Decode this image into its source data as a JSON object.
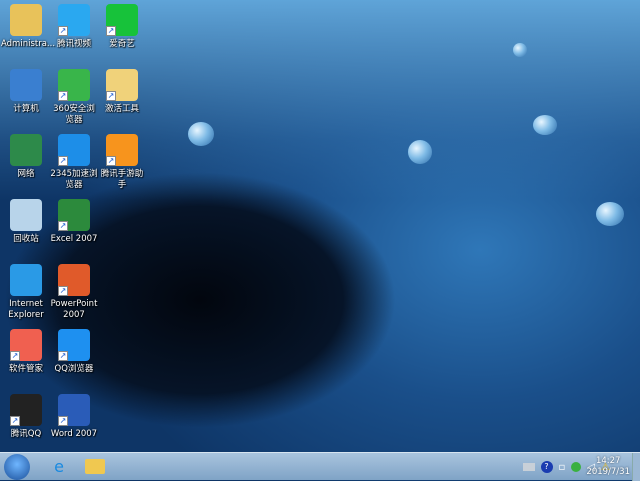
{
  "desktop": {
    "icons": [
      {
        "label": "Administra...",
        "icon": "user-folder-icon",
        "color": "#e8c25a",
        "shortcut": false
      },
      {
        "label": "腾讯视频",
        "icon": "tencent-video-icon",
        "color": "#2aa8f0",
        "shortcut": true
      },
      {
        "label": "爱奇艺",
        "icon": "iqiyi-icon",
        "color": "#17c23a",
        "shortcut": true
      },
      {
        "label": "计算机",
        "icon": "computer-icon",
        "color": "#3a7fd0",
        "shortcut": false
      },
      {
        "label": "360安全浏览器",
        "icon": "360-browser-icon",
        "color": "#39b54a",
        "shortcut": true
      },
      {
        "label": "激活工具",
        "icon": "folder-icon",
        "color": "#f0d27a",
        "shortcut": true
      },
      {
        "label": "网络",
        "icon": "network-icon",
        "color": "#2d8a4a",
        "shortcut": false
      },
      {
        "label": "2345加速浏览器",
        "icon": "2345-browser-icon",
        "color": "#1d8ee8",
        "shortcut": true
      },
      {
        "label": "腾讯手游助手",
        "icon": "tencent-game-assistant-icon",
        "color": "#f7941d",
        "shortcut": true
      },
      {
        "label": "回收站",
        "icon": "recycle-bin-icon",
        "color": "#b8d4ea",
        "shortcut": false
      },
      {
        "label": "Excel 2007",
        "icon": "excel-icon",
        "color": "#2c8a3c",
        "shortcut": true
      },
      {
        "label": "Internet Explorer",
        "icon": "ie-icon",
        "color": "#2a9ae6",
        "shortcut": false
      },
      {
        "label": "PowerPoint 2007",
        "icon": "powerpoint-icon",
        "color": "#e05a2a",
        "shortcut": true
      },
      {
        "label": "软件管家",
        "icon": "software-manager-icon",
        "color": "#f06050",
        "shortcut": true
      },
      {
        "label": "QQ浏览器",
        "icon": "qq-browser-icon",
        "color": "#1e90f0",
        "shortcut": true
      },
      {
        "label": "腾讯QQ",
        "icon": "qq-icon",
        "color": "#222222",
        "shortcut": true
      },
      {
        "label": "Word 2007",
        "icon": "word-icon",
        "color": "#2a5cb8",
        "shortcut": true
      }
    ]
  },
  "taskbar": {
    "pinned": [
      {
        "icon": "ie-icon"
      },
      {
        "icon": "file-explorer-icon"
      }
    ],
    "tray": [
      "keyboard-icon",
      "help-icon",
      "network-tray-icon",
      "usb-safely-remove-icon",
      "volume-icon",
      "action-center-warning-icon"
    ],
    "time": "14:27",
    "date": "2019/7/31"
  }
}
